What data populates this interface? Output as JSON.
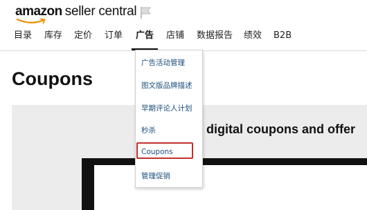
{
  "header": {
    "logo_brand": "amazon",
    "logo_product": "seller central"
  },
  "nav": {
    "items": [
      "目录",
      "库存",
      "定价",
      "订单",
      "广告",
      "店铺",
      "数据报告",
      "绩效",
      "B2B"
    ],
    "active": "广告"
  },
  "dropdown": {
    "items": [
      "广告活动管理",
      "图文版品牌描述",
      "早期评论人计划",
      "秒杀",
      "Coupons",
      "管理促销"
    ],
    "highlighted": "Coupons",
    "highlight_color": "#c0302c"
  },
  "page": {
    "title": "Coupons",
    "headline": "digital coupons and offer"
  },
  "icons": {
    "logo_smile": "amazon-smile-icon",
    "flag": "flag-icon"
  }
}
